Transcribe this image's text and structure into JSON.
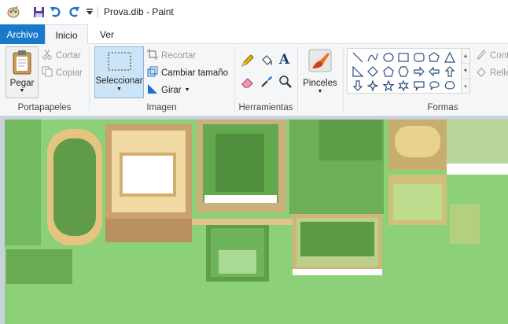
{
  "window": {
    "title": "Prova.dib - Paint"
  },
  "quick_access": {
    "icons": [
      "paint-app-icon",
      "save-icon",
      "undo-icon",
      "redo-icon",
      "customize-dropdown-icon"
    ]
  },
  "tabs": [
    {
      "label": "Archivo"
    },
    {
      "label": "Inicio"
    },
    {
      "label": "Ver"
    }
  ],
  "ribbon": {
    "clipboard": {
      "group_label": "Portapapeles",
      "paste": "Pegar",
      "cut": "Cortar",
      "copy": "Copiar"
    },
    "image": {
      "group_label": "Imagen",
      "select": "Seleccionar",
      "crop": "Recortar",
      "resize": "Cambiar tamaño",
      "rotate": "Girar"
    },
    "tools": {
      "group_label": "Herramientas"
    },
    "brushes": {
      "label": "Pinceles"
    },
    "shapes": {
      "group_label": "Formas",
      "outline": "Contorno",
      "fill": "Relleno"
    }
  },
  "colors": {
    "accent": "#1979ca",
    "canvas_grass": "#8cd077"
  }
}
